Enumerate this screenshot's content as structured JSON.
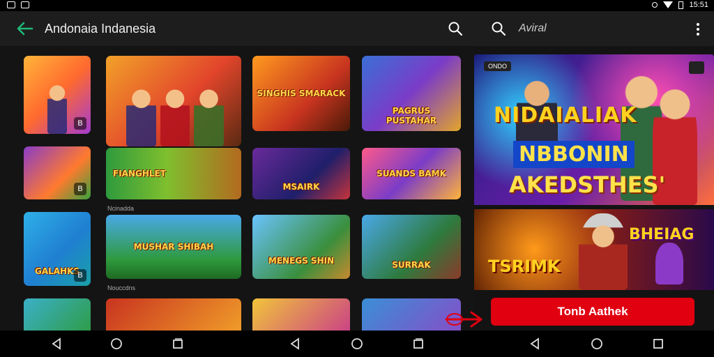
{
  "status_bar": {
    "time": "15:51",
    "icons": [
      "photo-icon",
      "image-icon",
      "alert-icon",
      "wifi-icon",
      "battery-icon"
    ]
  },
  "header": {
    "title": "Andonaia Indanesia",
    "back_icon": "arrow-left-icon",
    "search_icon": "search-icon"
  },
  "right_header": {
    "search_text": "Aviral",
    "more_icon": "more-vert-icon"
  },
  "grid": {
    "tiles": [
      {
        "caption": "",
        "badge": "B"
      },
      {
        "caption": "",
        "badge": ""
      },
      {
        "caption": "SINGHIS SMARACK",
        "badge": ""
      },
      {
        "caption": "PAGRUS PUSTAHAR",
        "badge": ""
      },
      {
        "caption": "",
        "badge": "B"
      },
      {
        "caption": "FIANGHLET",
        "badge": ""
      },
      {
        "caption": "MSAIRK",
        "badge": ""
      },
      {
        "caption": "SUANDS BAMK",
        "badge": ""
      },
      {
        "caption": "GALAHKS",
        "badge": "B"
      },
      {
        "caption": "MUSHAR SHIBAH",
        "badge": ""
      },
      {
        "caption": "MENEGS SHIN",
        "badge": ""
      },
      {
        "caption": "SURRAK",
        "badge": ""
      }
    ],
    "section_labels": [
      "Ncinadda",
      "Nouccdns"
    ],
    "accent_colors": [
      "#f29a22",
      "#7b3cc7",
      "#2e9a3d",
      "#1f7fd1",
      "#e2452b"
    ]
  },
  "hero": {
    "line1": "NIDAIALIAK",
    "line2": "NBBONIN",
    "line3": "AKEDSTHES'",
    "tag_left": "ONDO",
    "bottom_left": "TSRIMK",
    "bottom_right": "BHEIAG"
  },
  "cta": {
    "label": "Tonb Aathek",
    "color": "#e00010"
  },
  "nav": {
    "icons": [
      "back-triangle-icon",
      "home-circle-icon",
      "recents-square-icon"
    ]
  }
}
